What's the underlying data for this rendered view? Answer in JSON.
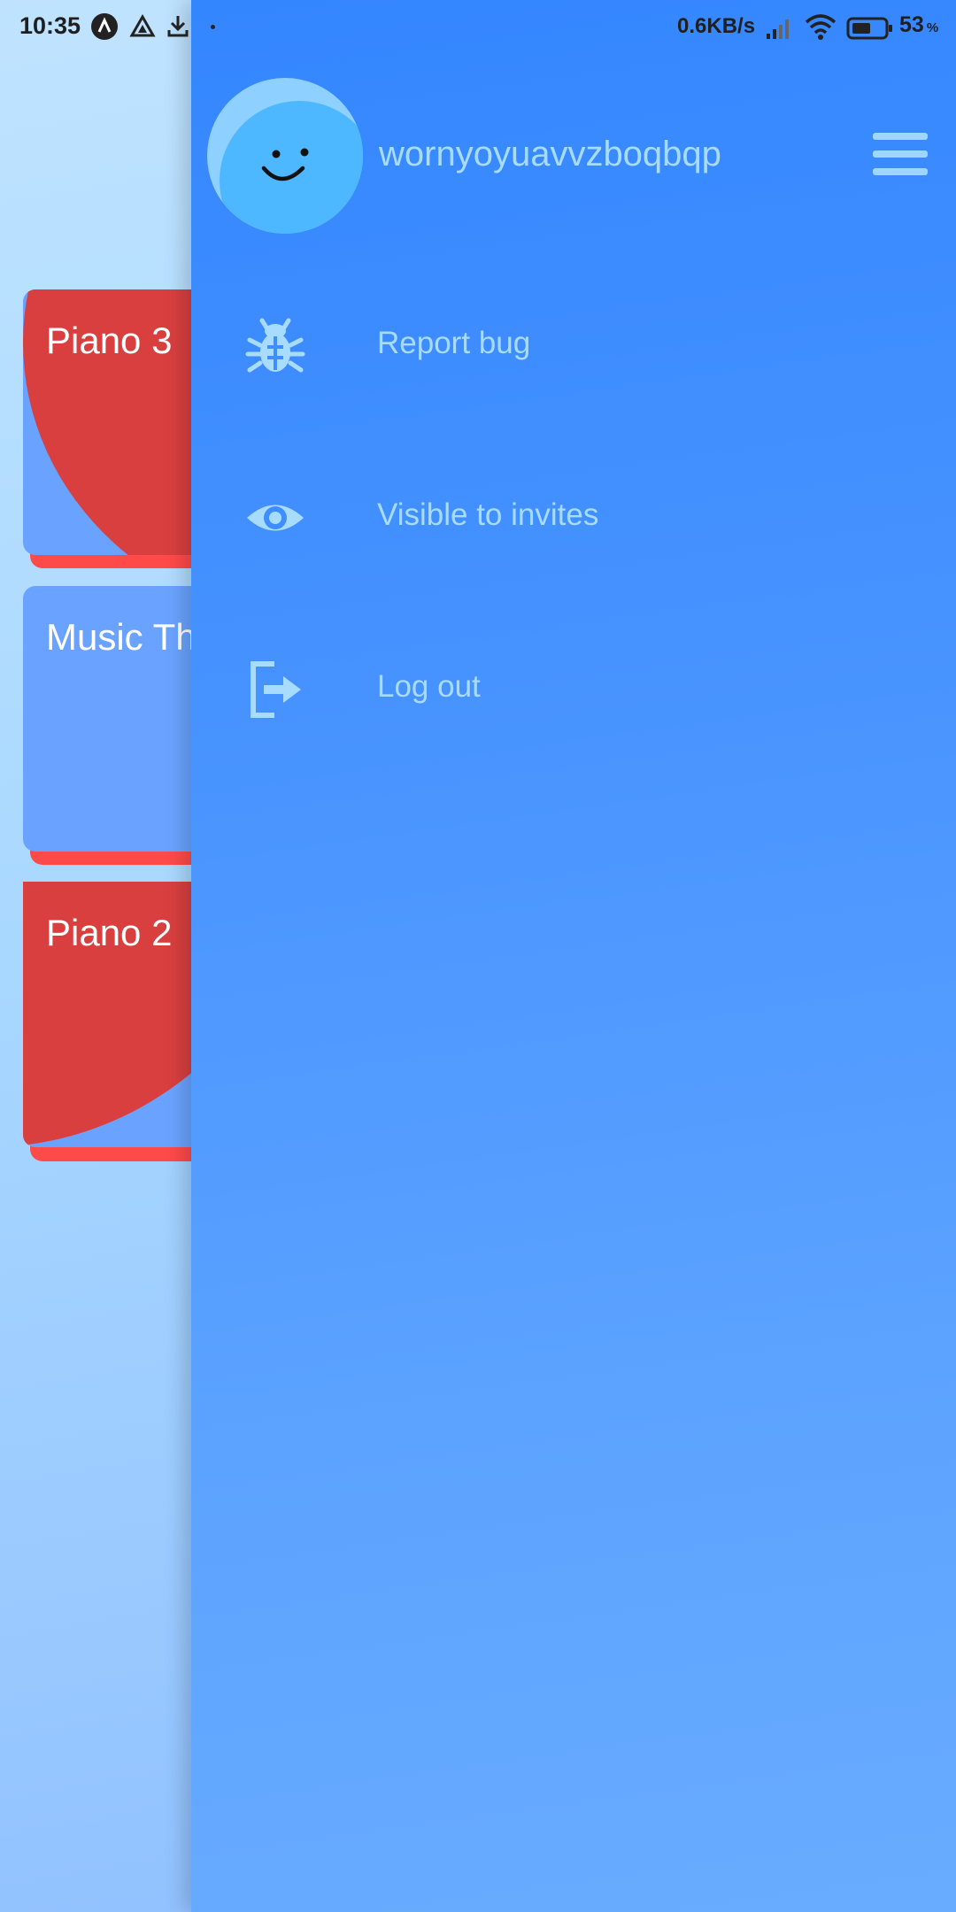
{
  "status_bar": {
    "time": "10:35",
    "network_speed": "0.6KB/s",
    "battery_percent": "53",
    "battery_unit": "%",
    "icons": [
      "a-icon",
      "drive-icon",
      "download-icon",
      "signal-icon",
      "wifi-icon",
      "battery-icon"
    ]
  },
  "cards": [
    {
      "title": "Piano 3"
    },
    {
      "title": "Music Th"
    },
    {
      "title": "Piano 2"
    }
  ],
  "drawer": {
    "username": "wornyoyuavvzboqbqp",
    "items": [
      {
        "label": "Report bug",
        "icon": "bug-icon"
      },
      {
        "label": "Visible to invites",
        "icon": "eye-icon"
      },
      {
        "label": "Log out",
        "icon": "logout-icon"
      }
    ]
  },
  "colors": {
    "drawer_top": "#3486ff",
    "drawer_bottom": "#68acff",
    "card_red": "#d93f3f",
    "card_blue": "#6aa3ff",
    "menu_text": "#a8dcff"
  }
}
